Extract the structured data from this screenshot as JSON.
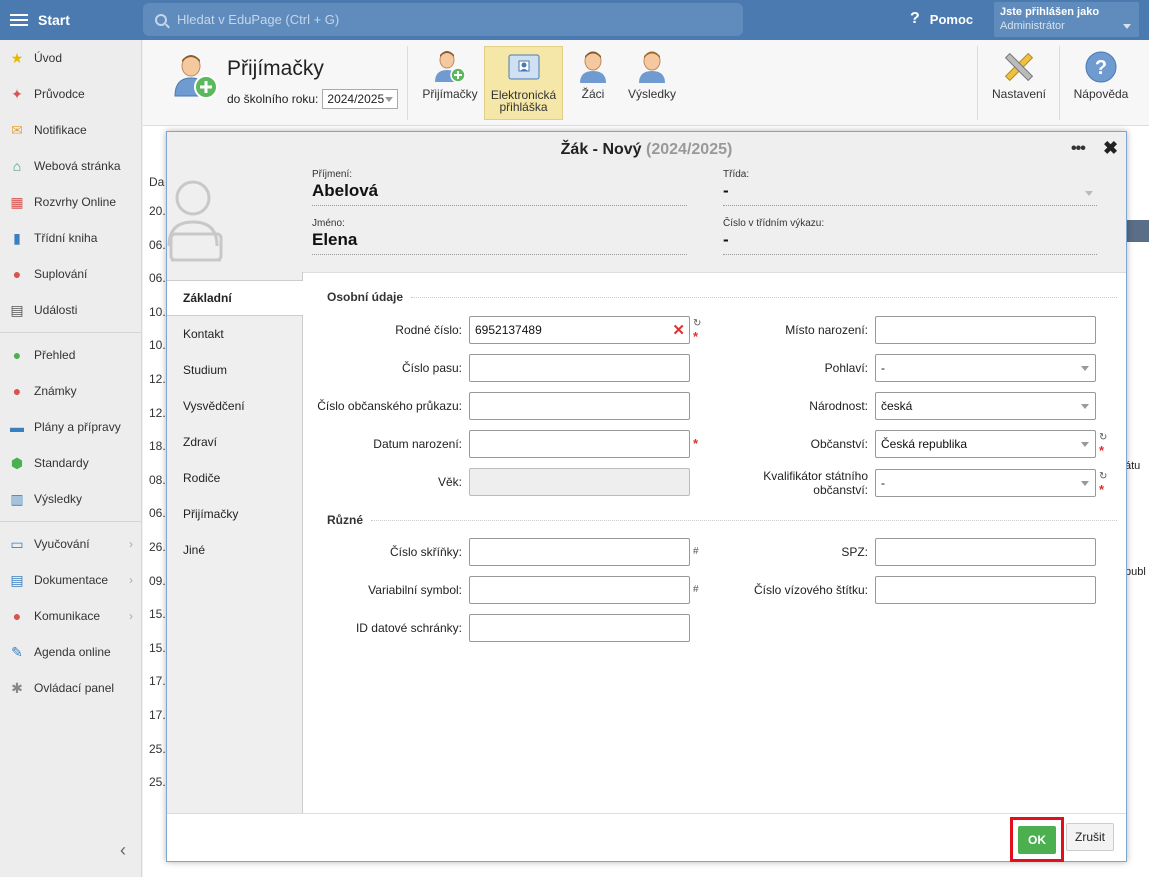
{
  "topbar": {
    "start_label": "Start",
    "search_placeholder": "Hledat v EduPage (Ctrl + G)",
    "help_label": "Pomoc",
    "user_line1": "Jste přihlášen jako",
    "user_line2": "Administrátor"
  },
  "sidebar": {
    "items": [
      {
        "label": "Úvod",
        "icon": "star-icon",
        "color": "#e6b800"
      },
      {
        "label": "Průvodce",
        "icon": "wand-icon",
        "color": "#d9534f"
      },
      {
        "label": "Notifikace",
        "icon": "envelope-icon",
        "color": "#e8a33c"
      },
      {
        "label": "Webová stránka",
        "icon": "house-icon",
        "color": "#3a9b78"
      },
      {
        "label": "Rozvrhy Online",
        "icon": "grid-icon",
        "color": "#d9534f"
      },
      {
        "label": "Třídní kniha",
        "icon": "book-icon",
        "color": "#3a7fc0"
      },
      {
        "label": "Suplování",
        "icon": "person-icon",
        "color": "#d9534f"
      },
      {
        "label": "Události",
        "icon": "calendar-icon",
        "color": "#555555"
      }
    ],
    "items2": [
      {
        "label": "Přehled",
        "icon": "check-circle-icon",
        "color": "#4caf50"
      },
      {
        "label": "Známky",
        "icon": "chart-circle-icon",
        "color": "#d9534f"
      },
      {
        "label": "Plány a přípravy",
        "icon": "briefcase-icon",
        "color": "#3a7fc0"
      },
      {
        "label": "Standardy",
        "icon": "shield-icon",
        "color": "#4caf50"
      },
      {
        "label": "Výsledky",
        "icon": "bars-icon",
        "color": "#3a7fc0"
      }
    ],
    "items3": [
      {
        "label": "Vyučování",
        "icon": "open-book-icon",
        "color": "#3a7fc0",
        "arrow": "›"
      },
      {
        "label": "Dokumentace",
        "icon": "document-icon",
        "color": "#3a7fc0",
        "arrow": "›"
      },
      {
        "label": "Komunikace",
        "icon": "chat-icon",
        "color": "#d9534f",
        "arrow": "›"
      },
      {
        "label": "Agenda online",
        "icon": "pen-icon",
        "color": "#3a7fc0",
        "arrow": ""
      },
      {
        "label": "Ovládací panel",
        "icon": "gear-icon",
        "color": "#888888",
        "arrow": ""
      }
    ],
    "collapse_glyph": "‹"
  },
  "header": {
    "title": "Přijímačky",
    "year_label": "do školního roku:",
    "year_value": "2024/2025",
    "tools": [
      {
        "label": "Přijímačky"
      },
      {
        "label": "Elektronická přihláška"
      },
      {
        "label": "Žáci"
      },
      {
        "label": "Výsledky"
      },
      {
        "label": "Nastavení"
      },
      {
        "label": "Nápověda"
      }
    ]
  },
  "background": {
    "col_header": "Da",
    "rows": [
      "20.",
      "06.",
      "06.",
      "10.",
      "10.",
      "12.",
      "12.",
      "18.",
      "08.",
      "06.",
      "26.",
      "09.",
      "15.",
      "15.",
      "17.",
      "17.",
      "25.",
      "25."
    ],
    "right_fragments": [
      "átu",
      "publ"
    ]
  },
  "dialog": {
    "title": "Žák - Nový",
    "title_year": "(2024/2025)",
    "more_glyph": "•••",
    "close_glyph": "✖",
    "surname_label": "Příjmení:",
    "surname_value": "Abelová",
    "firstname_label": "Jméno:",
    "firstname_value": "Elena",
    "class_label": "Třída:",
    "class_value": "-",
    "register_label": "Číslo v třídním výkazu:",
    "register_value": "-",
    "tabs": [
      "Základní",
      "Kontakt",
      "Studium",
      "Vysvědčení",
      "Zdraví",
      "Rodiče",
      "Přijímačky",
      "Jiné"
    ],
    "section_personal": "Osobní údaje",
    "section_misc": "Různé",
    "fields": {
      "rodne_cislo_label": "Rodné číslo:",
      "rodne_cislo_value": "6952137489",
      "cislo_pasu_label": "Číslo pasu:",
      "cislo_op_label": "Číslo občanského průkazu:",
      "datum_narozeni_label": "Datum narození:",
      "vek_label": "Věk:",
      "misto_narozeni_label": "Místo narození:",
      "pohlavi_label": "Pohlaví:",
      "pohlavi_value": "-",
      "narodnost_label": "Národnost:",
      "narodnost_value": "česká",
      "obcanstvi_label": "Občanství:",
      "obcanstvi_value": "Česká republika",
      "kvalifikator_label_1": "Kvalifikátor státního",
      "kvalifikator_label_2": "občanství:",
      "kvalifikator_value": "-",
      "cislo_skrinky_label": "Číslo skříňky:",
      "variabilni_symbol_label": "Variabilní symbol:",
      "id_ds_label": "ID datové schránky:",
      "spz_label": "SPZ:",
      "cislo_viz_label": "Číslo vízového štítku:"
    },
    "marks": {
      "refresh": "↻",
      "required": "*",
      "hash": "#",
      "clear": "✕"
    },
    "ok_label": "OK",
    "cancel_label": "Zrušit"
  }
}
